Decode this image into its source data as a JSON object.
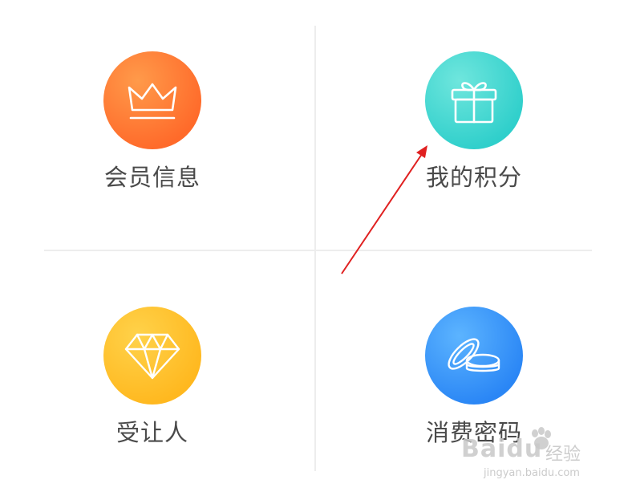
{
  "menu": {
    "items": [
      {
        "label": "会员信息",
        "icon": "crown-icon",
        "color": "#ff7a35"
      },
      {
        "label": "我的积分",
        "icon": "gift-icon",
        "color": "#3dd6d0"
      },
      {
        "label": "受让人",
        "icon": "diamond-icon",
        "color": "#ffc12e"
      },
      {
        "label": "消费密码",
        "icon": "coins-icon",
        "color": "#3a96fb"
      }
    ]
  },
  "annotation": {
    "color": "#e02020"
  },
  "watermark": {
    "logo_a": "Bai",
    "logo_b": "du",
    "cn": "经验",
    "url": "jingyan.baidu.com"
  }
}
